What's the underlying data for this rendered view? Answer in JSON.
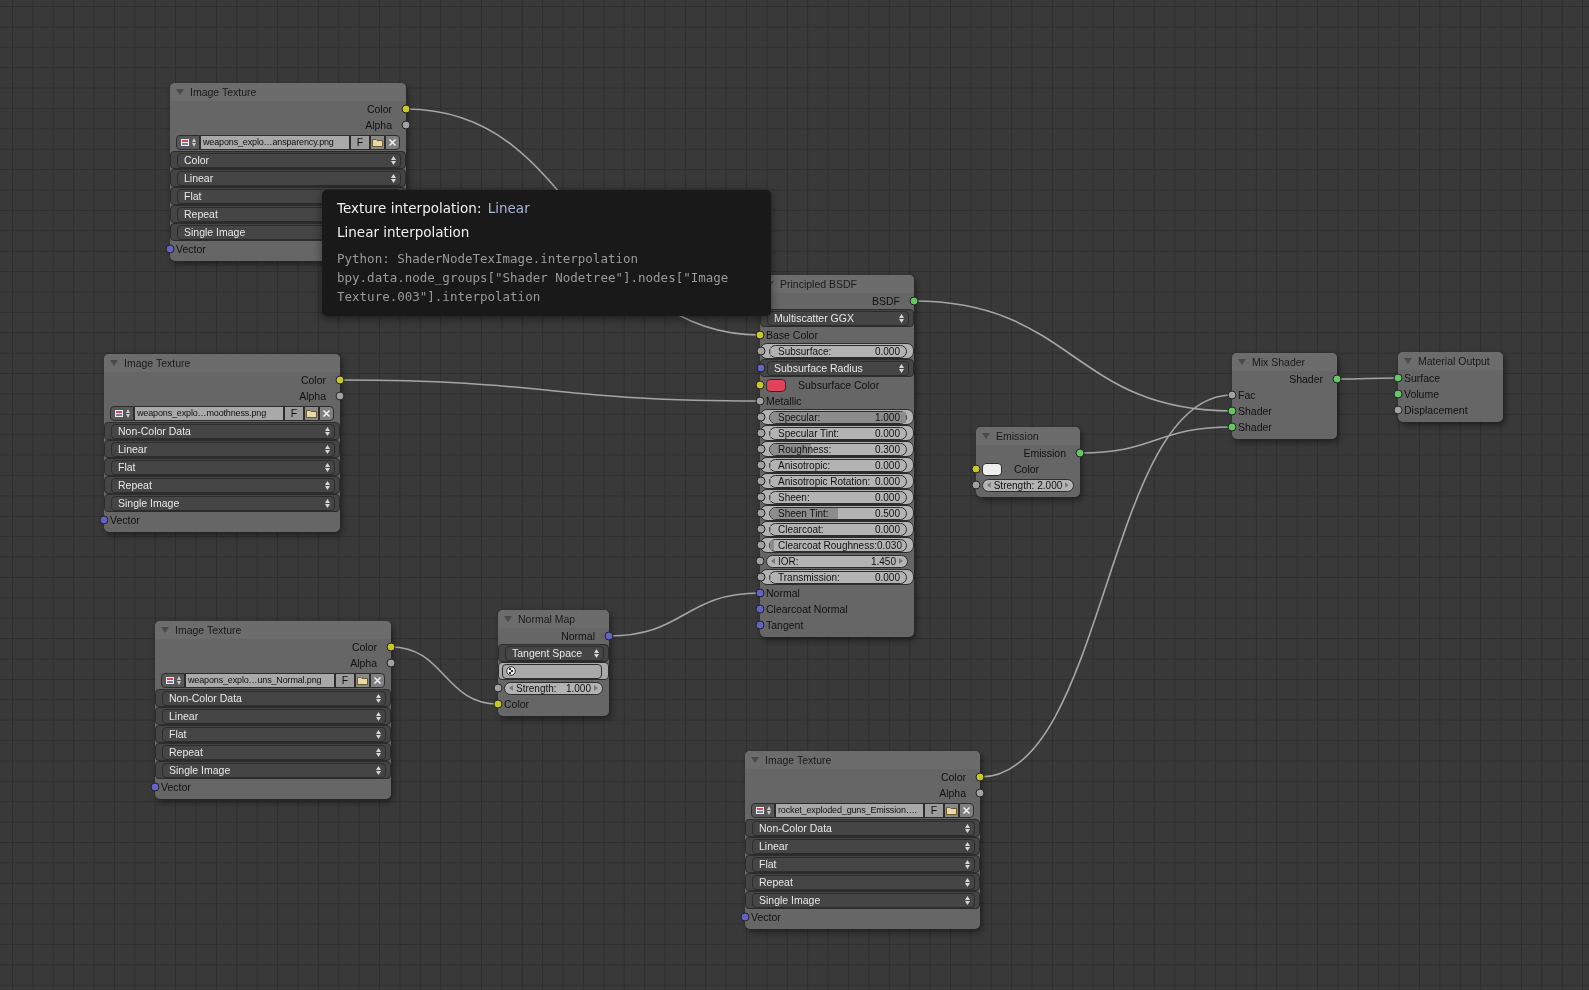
{
  "nodes": [
    {
      "title": "Image Texture",
      "rows": [
        {
          "kind": "output",
          "label": "Color",
          "socket": {
            "color": "#c7c729"
          }
        },
        {
          "kind": "output",
          "label": "Alpha",
          "socket": {
            "color": "#a1a1a1"
          }
        },
        {
          "kind": "image",
          "file": "weapons_explo…ansparency.png",
          "flag": "F"
        },
        {
          "kind": "menu",
          "value": "Color"
        },
        {
          "kind": "menu",
          "value": "Linear"
        },
        {
          "kind": "menu",
          "value": "Flat"
        },
        {
          "kind": "menu",
          "value": "Repeat"
        },
        {
          "kind": "menu",
          "value": "Single Image"
        },
        {
          "kind": "input",
          "label": "Vector",
          "socket": {
            "color": "#6363c7"
          }
        }
      ]
    },
    {
      "title": "Principled BSDF",
      "rows": [
        {
          "kind": "output",
          "label": "BSDF",
          "socket": {
            "color": "#63c763"
          }
        },
        {
          "kind": "menu",
          "value": "Multiscatter GGX"
        },
        {
          "kind": "input",
          "label": "Base Color",
          "socket": {
            "color": "#c7c729"
          }
        },
        {
          "kind": "slider",
          "label": "Subsurface:",
          "value": "0.000",
          "level": 0,
          "socket": {
            "color": "#a1a1a1"
          }
        },
        {
          "kind": "menu",
          "value": "Subsurface Radius",
          "socket": {
            "color": "#6363c7"
          }
        },
        {
          "kind": "color",
          "label": "Subsurface Color",
          "color": "#e0435a",
          "socket": {
            "color": "#c7c729"
          }
        },
        {
          "kind": "input",
          "label": "Metallic",
          "socket": {
            "color": "#a1a1a1"
          }
        },
        {
          "kind": "slider",
          "label": "Specular:",
          "value": "1.000",
          "level": 1,
          "socket": {
            "color": "#a1a1a1"
          }
        },
        {
          "kind": "slider",
          "label": "Specular Tint:",
          "value": "0.000",
          "level": 0,
          "socket": {
            "color": "#a1a1a1"
          }
        },
        {
          "kind": "slider",
          "label": "Roughness:",
          "value": "0.300",
          "level": 0.3,
          "socket": {
            "color": "#a1a1a1"
          }
        },
        {
          "kind": "slider",
          "label": "Anisotropic:",
          "value": "0.000",
          "level": 0,
          "socket": {
            "color": "#a1a1a1"
          }
        },
        {
          "kind": "slider",
          "label": "Anisotropic Rotation:",
          "value": "0.000",
          "level": 0,
          "socket": {
            "color": "#a1a1a1"
          }
        },
        {
          "kind": "slider",
          "label": "Sheen:",
          "value": "0.000",
          "level": 0,
          "socket": {
            "color": "#a1a1a1"
          }
        },
        {
          "kind": "slider",
          "label": "Sheen Tint:",
          "value": "0.500",
          "level": 0.5,
          "socket": {
            "color": "#a1a1a1"
          }
        },
        {
          "kind": "slider",
          "label": "Clearcoat:",
          "value": "0.000",
          "level": 0,
          "socket": {
            "color": "#a1a1a1"
          }
        },
        {
          "kind": "slider",
          "label": "Clearcoat Roughness:",
          "value": "0.030",
          "level": 0.03,
          "socket": {
            "color": "#a1a1a1"
          }
        },
        {
          "kind": "number",
          "label": "IOR:",
          "value": "1.450",
          "socket": {
            "color": "#a1a1a1"
          }
        },
        {
          "kind": "slider",
          "label": "Transmission:",
          "value": "0.000",
          "level": 0,
          "socket": {
            "color": "#a1a1a1"
          }
        },
        {
          "kind": "input",
          "label": "Normal",
          "socket": {
            "color": "#6363c7"
          }
        },
        {
          "kind": "input",
          "label": "Clearcoat Normal",
          "socket": {
            "color": "#6363c7"
          }
        },
        {
          "kind": "input",
          "label": "Tangent",
          "socket": {
            "color": "#6363c7"
          }
        }
      ]
    },
    {
      "title": "Image Texture",
      "rows": [
        {
          "kind": "output",
          "label": "Color",
          "socket": {
            "color": "#c7c729"
          }
        },
        {
          "kind": "output",
          "label": "Alpha",
          "socket": {
            "color": "#a1a1a1"
          }
        },
        {
          "kind": "image",
          "file": "weapons_explo…moothness.png",
          "flag": "F"
        },
        {
          "kind": "menu",
          "value": "Non-Color Data"
        },
        {
          "kind": "menu",
          "value": "Linear"
        },
        {
          "kind": "menu",
          "value": "Flat"
        },
        {
          "kind": "menu",
          "value": "Repeat"
        },
        {
          "kind": "menu",
          "value": "Single Image"
        },
        {
          "kind": "input",
          "label": "Vector",
          "socket": {
            "color": "#6363c7"
          }
        }
      ]
    },
    {
      "title": "Mix Shader",
      "rows": [
        {
          "kind": "output",
          "label": "Shader",
          "socket": {
            "color": "#63c763"
          }
        },
        {
          "kind": "input",
          "label": "Fac",
          "socket": {
            "color": "#a1a1a1"
          }
        },
        {
          "kind": "input",
          "label": "Shader",
          "socket": {
            "color": "#63c763"
          }
        },
        {
          "kind": "input",
          "label": "Shader",
          "socket": {
            "color": "#63c763"
          }
        }
      ]
    },
    {
      "title": "Material Output",
      "rows": [
        {
          "kind": "input",
          "label": "Surface",
          "socket": {
            "color": "#63c763"
          }
        },
        {
          "kind": "input",
          "label": "Volume",
          "socket": {
            "color": "#63c763"
          }
        },
        {
          "kind": "input",
          "label": "Displacement",
          "socket": {
            "color": "#a1a1a1"
          }
        }
      ]
    },
    {
      "title": "Emission",
      "rows": [
        {
          "kind": "output",
          "label": "Emission",
          "socket": {
            "color": "#63c763"
          }
        },
        {
          "kind": "color",
          "label": "Color",
          "color": "#eeeeee",
          "socket": {
            "color": "#c7c729"
          }
        },
        {
          "kind": "number",
          "label": "Strength:",
          "value": "2.000",
          "socket": {
            "color": "#a1a1a1"
          }
        }
      ]
    },
    {
      "title": "Image Texture",
      "rows": [
        {
          "kind": "output",
          "label": "Color",
          "socket": {
            "color": "#c7c729"
          }
        },
        {
          "kind": "output",
          "label": "Alpha",
          "socket": {
            "color": "#a1a1a1"
          }
        },
        {
          "kind": "image",
          "file": "weapons_explo…uns_Normal.png",
          "flag": "F"
        },
        {
          "kind": "menu",
          "value": "Non-Color Data"
        },
        {
          "kind": "menu",
          "value": "Linear"
        },
        {
          "kind": "menu",
          "value": "Flat"
        },
        {
          "kind": "menu",
          "value": "Repeat"
        },
        {
          "kind": "menu",
          "value": "Single Image"
        },
        {
          "kind": "input",
          "label": "Vector",
          "socket": {
            "color": "#6363c7"
          }
        }
      ]
    },
    {
      "title": "Normal Map",
      "rows": [
        {
          "kind": "output",
          "label": "Normal",
          "socket": {
            "color": "#6363c7"
          }
        },
        {
          "kind": "menu",
          "value": "Tangent Space"
        },
        {
          "kind": "field"
        },
        {
          "kind": "number",
          "label": "Strength:",
          "value": "1.000",
          "socket": {
            "color": "#a1a1a1"
          }
        },
        {
          "kind": "input",
          "label": "Color",
          "socket": {
            "color": "#c7c729"
          }
        }
      ]
    },
    {
      "title": "Image Texture",
      "rows": [
        {
          "kind": "output",
          "label": "Color",
          "socket": {
            "color": "#c7c729"
          }
        },
        {
          "kind": "output",
          "label": "Alpha",
          "socket": {
            "color": "#a1a1a1"
          }
        },
        {
          "kind": "image",
          "file": "rocket_exploded_guns_Emission….",
          "flag": "F"
        },
        {
          "kind": "menu",
          "value": "Non-Color Data"
        },
        {
          "kind": "menu",
          "value": "Linear"
        },
        {
          "kind": "menu",
          "value": "Flat"
        },
        {
          "kind": "menu",
          "value": "Repeat"
        },
        {
          "kind": "menu",
          "value": "Single Image"
        },
        {
          "kind": "input",
          "label": "Vector",
          "socket": {
            "color": "#6363c7"
          }
        }
      ]
    }
  ],
  "tooltip": {
    "title": "Texture interpolation:",
    "value": "Linear",
    "description": "Linear interpolation",
    "code_lines": [
      "Python: ShaderNodeTexImage.interpolation",
      "bpy.data.node_groups[\"Shader Nodetree\"].nodes[\"Image",
      "Texture.003\"].interpolation"
    ]
  }
}
